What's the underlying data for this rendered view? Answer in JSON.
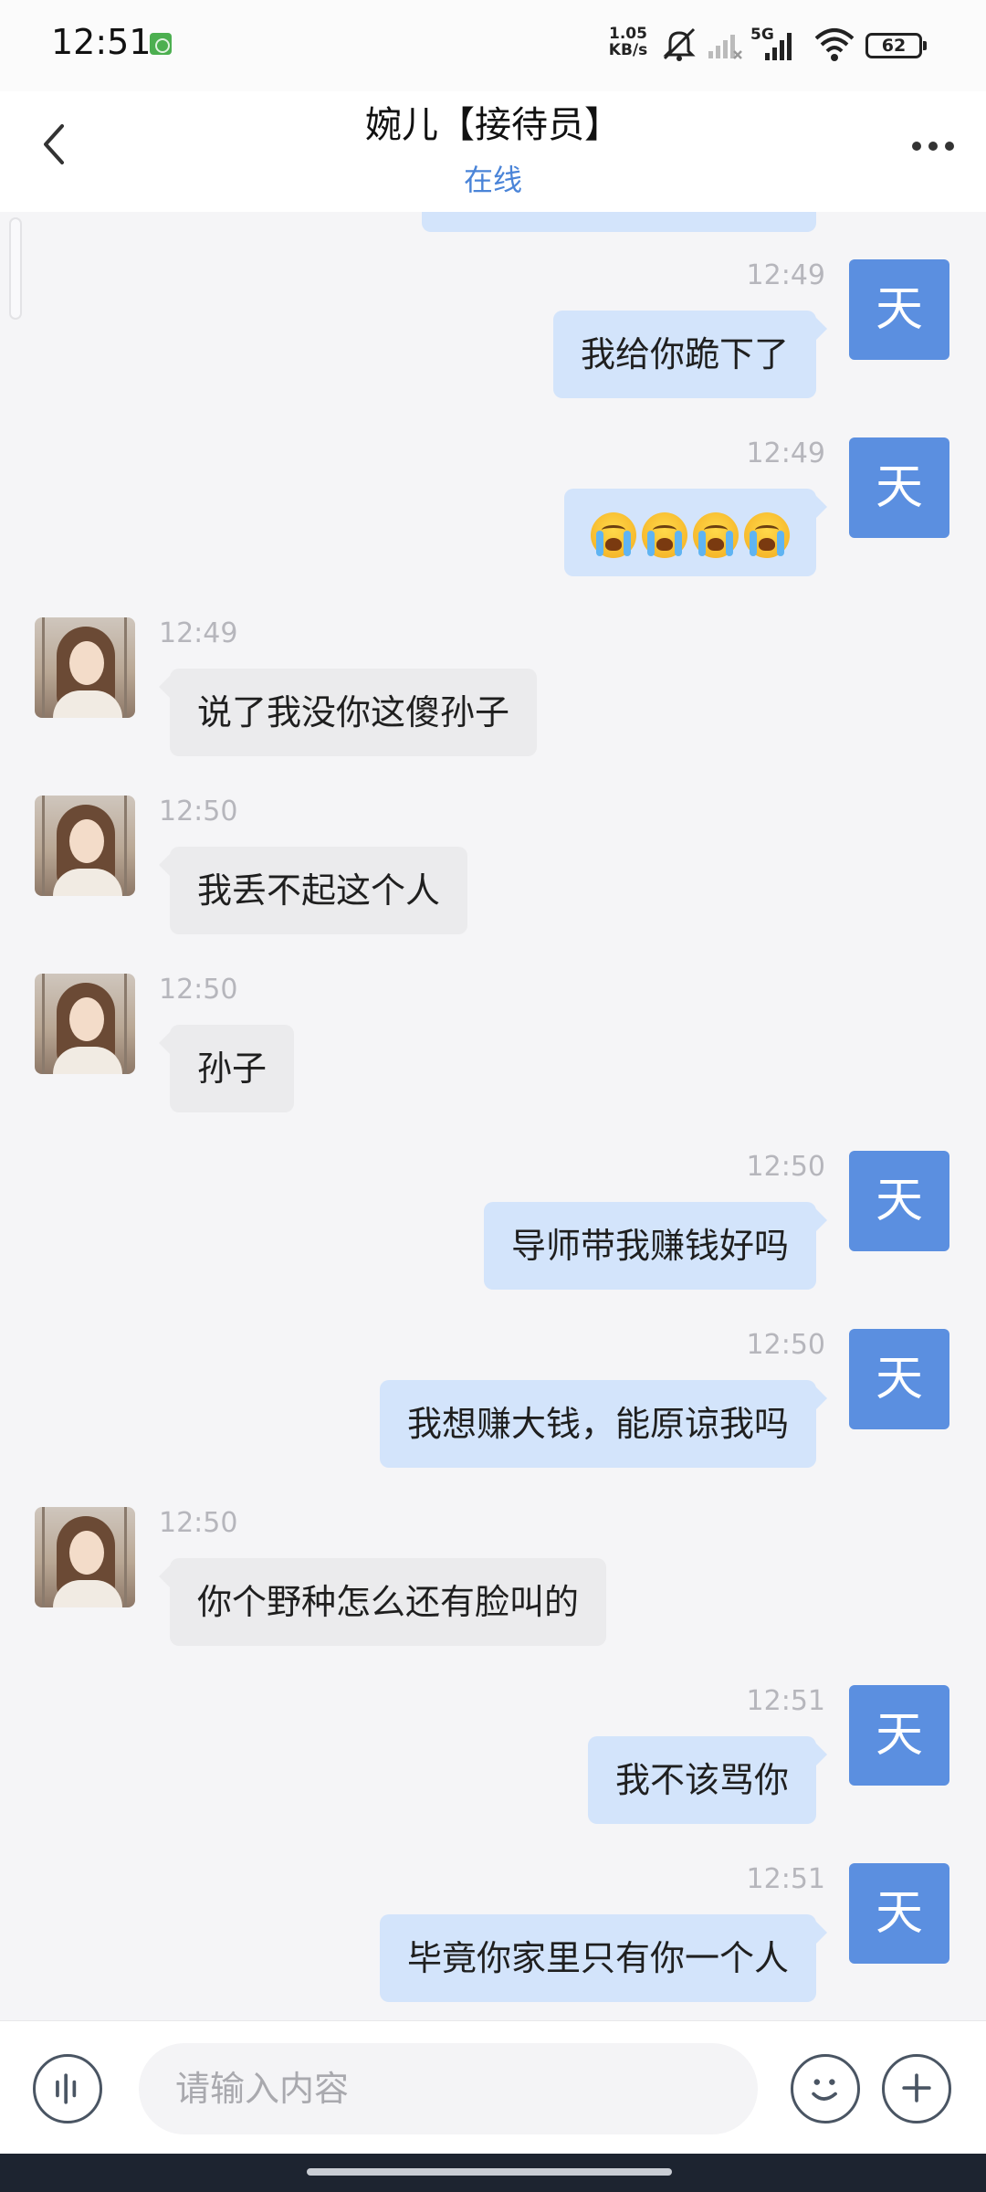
{
  "status_bar": {
    "time": "12:51",
    "net_speed_value": "1.05",
    "net_speed_unit": "KB/s",
    "network_label": "5G",
    "battery_level": "62",
    "icons": [
      "app-notification-icon",
      "mute-bell-icon",
      "signal-off-icon",
      "signal-5g-icon",
      "wifi-icon",
      "battery-icon"
    ]
  },
  "header": {
    "title": "婉儿【接待员】",
    "status": "在线",
    "back_icon": "chevron-left-icon",
    "more_icon": "more-dots-icon"
  },
  "self_avatar_text": "天",
  "messages": [
    {
      "side": "right",
      "time": "12:49",
      "text": "我给你跪下了"
    },
    {
      "side": "right",
      "time": "12:49",
      "text": "",
      "emoji": [
        "loudly-crying-face",
        "loudly-crying-face",
        "loudly-crying-face",
        "loudly-crying-face"
      ]
    },
    {
      "side": "left",
      "time": "12:49",
      "text": "说了我没你这傻孙子"
    },
    {
      "side": "left",
      "time": "12:50",
      "text": "我丢不起这个人"
    },
    {
      "side": "left",
      "time": "12:50",
      "text": "孙子"
    },
    {
      "side": "right",
      "time": "12:50",
      "text": "导师带我赚钱好吗"
    },
    {
      "side": "right",
      "time": "12:50",
      "text": "我想赚大钱，能原谅我吗"
    },
    {
      "side": "left",
      "time": "12:50",
      "text": "你个野种怎么还有脸叫的"
    },
    {
      "side": "right",
      "time": "12:51",
      "text": "我不该骂你"
    },
    {
      "side": "right",
      "time": "12:51",
      "text": "毕竟你家里只有你一个人"
    }
  ],
  "input_bar": {
    "placeholder": "请输入内容",
    "voice_icon": "voice-icon",
    "emoji_icon": "smile-icon",
    "plus_icon": "plus-icon"
  },
  "colors": {
    "self_bubble": "#d3e4fb",
    "peer_bubble": "#ebebed",
    "self_avatar": "#5b8fe0",
    "online_status": "#4a84d8"
  }
}
